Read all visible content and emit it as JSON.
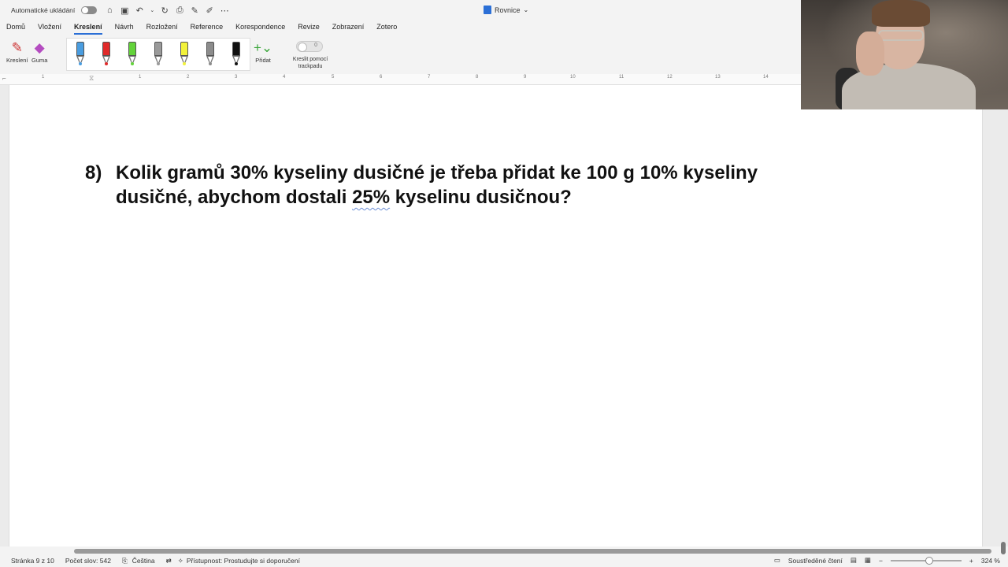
{
  "titlebar": {
    "autosave_label": "Automatické ukládání",
    "document_title": "Rovnice",
    "quick_icons": [
      "home-icon",
      "save-icon",
      "undo-icon",
      "redo-icon",
      "print-icon",
      "pen-icon",
      "form-icon",
      "more-icon"
    ]
  },
  "ribbon": {
    "tabs": [
      "Domů",
      "Vložení",
      "Kreslení",
      "Návrh",
      "Rozložení",
      "Reference",
      "Korespondence",
      "Revize",
      "Zobrazení",
      "Zotero"
    ],
    "active_tab": "Kreslení",
    "draw_label": "Kreslení",
    "eraser_label": "Guma",
    "add_label": "Přidat",
    "trackpad_label": "Kreslit pomocí trackpadu",
    "trackpad_toggle_value": "0",
    "pens": [
      {
        "color": "#4a9de0"
      },
      {
        "color": "#e02a2a"
      },
      {
        "color": "#63d33a"
      },
      {
        "color": "#9a9a9a"
      },
      {
        "color": "#f2f23a"
      },
      {
        "color": "#8c8c8c"
      },
      {
        "color": "#111111"
      }
    ]
  },
  "ruler": {
    "numbers": [
      "1",
      "1",
      "2",
      "3",
      "4",
      "5",
      "6",
      "7",
      "8",
      "9",
      "10",
      "11",
      "12",
      "13",
      "14"
    ]
  },
  "document": {
    "question_number": "8)",
    "question_part1": "Kolik gramů 30% kyseliny dusičné je třeba přidat ke 100 g 10% kyseliny dusičné, abychom dostali ",
    "question_underlined": "25%",
    "question_part2": " kyselinu dusičnou?"
  },
  "statusbar": {
    "page": "Stránka 9 z 10",
    "words": "Počet slov: 542",
    "language": "Čeština",
    "accessibility": "Přístupnost: Prostudujte si doporučení",
    "focus": "Soustředěné čtení",
    "zoom": "324 %"
  },
  "colors": {
    "accent": "#2b6fd6"
  }
}
